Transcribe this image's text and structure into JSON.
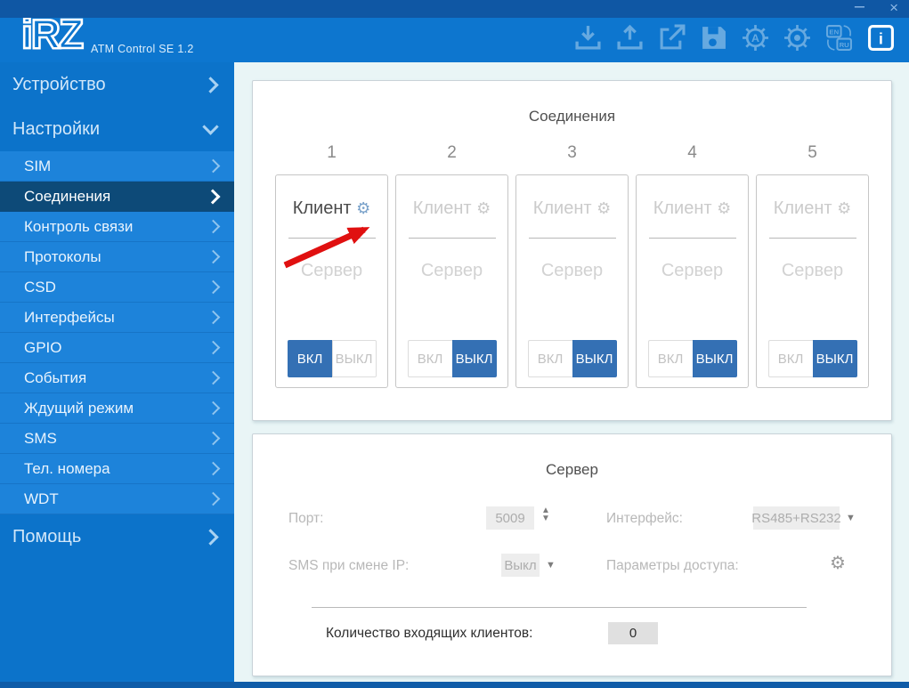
{
  "window": {
    "logo": "iRZ",
    "title": "ATM Control SE 1.2",
    "minimize": "–",
    "close": "×"
  },
  "toolbar": {
    "lang_en": "EN",
    "lang_ru": "RU",
    "gear_letter": "A",
    "info_letter": "i"
  },
  "sidebar": {
    "items": [
      {
        "label": "Устройство"
      },
      {
        "label": "Настройки"
      },
      {
        "label": "Помощь"
      }
    ],
    "subitems": [
      {
        "label": "SIM"
      },
      {
        "label": "Соединения"
      },
      {
        "label": "Контроль связи"
      },
      {
        "label": "Протоколы"
      },
      {
        "label": "CSD"
      },
      {
        "label": "Интерфейсы"
      },
      {
        "label": "GPIO"
      },
      {
        "label": "События"
      },
      {
        "label": "Ждущий режим"
      },
      {
        "label": "SMS"
      },
      {
        "label": "Тел. номера"
      },
      {
        "label": "WDT"
      }
    ]
  },
  "connections": {
    "title": "Соединения",
    "cards": [
      {
        "number": "1",
        "client": "Клиент",
        "server": "Сервер",
        "on": "ВКЛ",
        "off": "ВЫКЛ",
        "state": "on"
      },
      {
        "number": "2",
        "client": "Клиент",
        "server": "Сервер",
        "on": "ВКЛ",
        "off": "ВЫКЛ",
        "state": "off"
      },
      {
        "number": "3",
        "client": "Клиент",
        "server": "Сервер",
        "on": "ВКЛ",
        "off": "ВЫКЛ",
        "state": "off"
      },
      {
        "number": "4",
        "client": "Клиент",
        "server": "Сервер",
        "on": "ВКЛ",
        "off": "ВЫКЛ",
        "state": "off"
      },
      {
        "number": "5",
        "client": "Клиент",
        "server": "Сервер",
        "on": "ВКЛ",
        "off": "ВЫКЛ",
        "state": "off"
      }
    ]
  },
  "server": {
    "title": "Сервер",
    "port_label": "Порт:",
    "port_value": "5009",
    "interface_label": "Интерфейс:",
    "interface_value": "RS485+RS232",
    "sms_label": "SMS при смене IP:",
    "sms_value": "Выкл",
    "access_label": "Параметры доступа:",
    "incoming_label": "Количество входящих клиентов:",
    "incoming_value": "0"
  },
  "colors": {
    "titlebar": "#0f57a4",
    "header": "#0d76cf",
    "submenu": "#1d83da",
    "selected_item": "#0d4a78",
    "toggle_active": "#3470b4",
    "annotation_arrow": "#e01010",
    "content_bg": "#e9f5f6"
  }
}
